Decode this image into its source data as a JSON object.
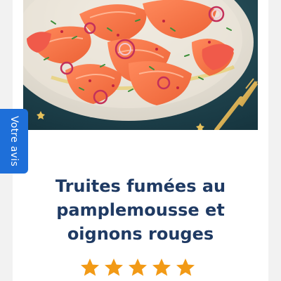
{
  "feedback": {
    "label": "Votre avis"
  },
  "recipe": {
    "title": "Truites fumées au pamplemousse et oignons rouges",
    "rating": 5,
    "rating_max": 5
  },
  "colors": {
    "accent_blue": "#1e6fd9",
    "title_navy": "#1f3a63",
    "star_orange": "#f29a16"
  },
  "icons": {
    "star": "star-icon",
    "feedback": "feedback-tab"
  }
}
